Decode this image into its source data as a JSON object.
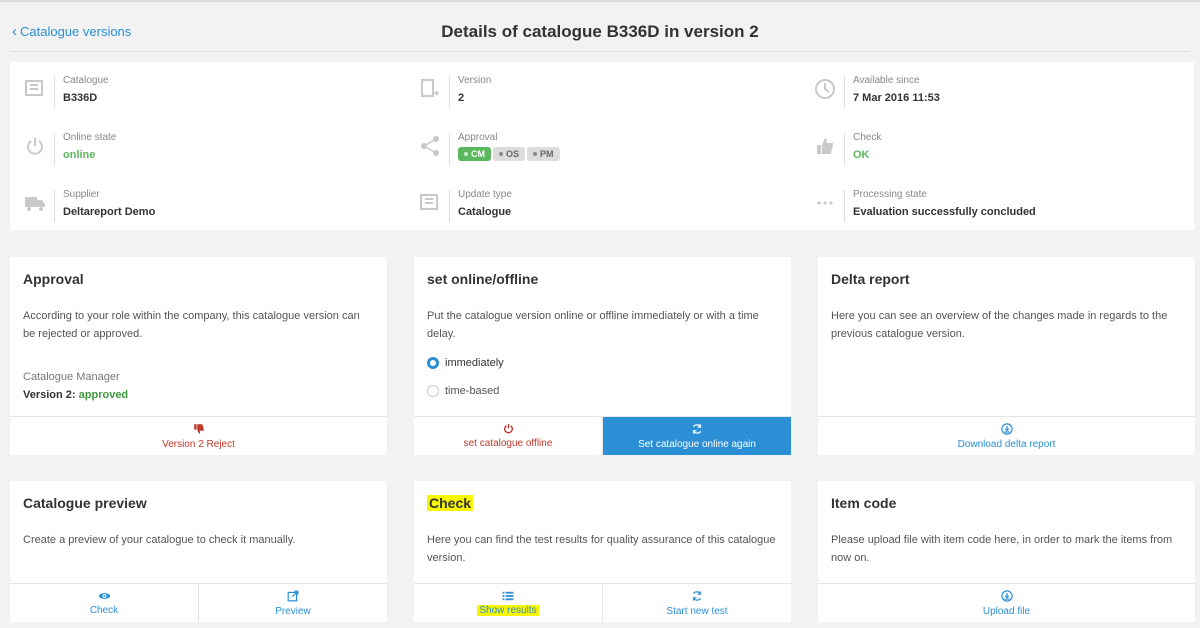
{
  "header": {
    "back_label": "Catalogue versions",
    "title": "Details of catalogue B336D in version 2"
  },
  "details": {
    "catalogue": {
      "label": "Catalogue",
      "value": "B336D"
    },
    "version": {
      "label": "Version",
      "value": "2"
    },
    "available": {
      "label": "Available since",
      "value": "7 Mar 2016 11:53"
    },
    "online_state": {
      "label": "Online state",
      "value": "online"
    },
    "approval": {
      "label": "Approval",
      "pills": [
        "CM",
        "OS",
        "PM"
      ]
    },
    "check": {
      "label": "Check",
      "value": "OK"
    },
    "supplier": {
      "label": "Supplier",
      "value": "Deltareport Demo"
    },
    "update_type": {
      "label": "Update type",
      "value": "Catalogue"
    },
    "processing": {
      "label": "Processing state",
      "value": "Evaluation successfully concluded"
    }
  },
  "approval_card": {
    "title": "Approval",
    "desc": "According to your role within the company, this catalogue version can be rejected or approved.",
    "role": "Catalogue Manager",
    "version_prefix": "Version 2: ",
    "version_status": "approved",
    "reject_label": "Version 2 Reject"
  },
  "online_card": {
    "title": "set online/offline",
    "desc": "Put the catalogue version online or offline immediately or with a time delay.",
    "opt_immediately": "immediately",
    "opt_timebased": "time-based",
    "offline_label": "set catalogue offline",
    "online_label": "Set catalogue online again"
  },
  "delta_card": {
    "title": "Delta report",
    "desc": "Here you can see an overview of the changes made in regards to the previous catalogue version.",
    "download_label": "Download delta report"
  },
  "preview_card": {
    "title": "Catalogue preview",
    "desc": "Create a preview of your catalogue to check it manually.",
    "check_label": "Check",
    "preview_label": "Preview"
  },
  "check_card": {
    "title": "Check",
    "desc": "Here you can find the test results for quality assurance of this catalogue version.",
    "results_label": "Show results",
    "newtest_label": "Start new test"
  },
  "itemcode_card": {
    "title": "Item code",
    "desc": "Please upload file with item code here, in order to mark the items from now on.",
    "upload_label": "Upload file"
  },
  "colors": {
    "accent": "#2a8fd4",
    "green": "#5cb85c",
    "red": "#c0392b",
    "highlight": "#f7f500"
  }
}
